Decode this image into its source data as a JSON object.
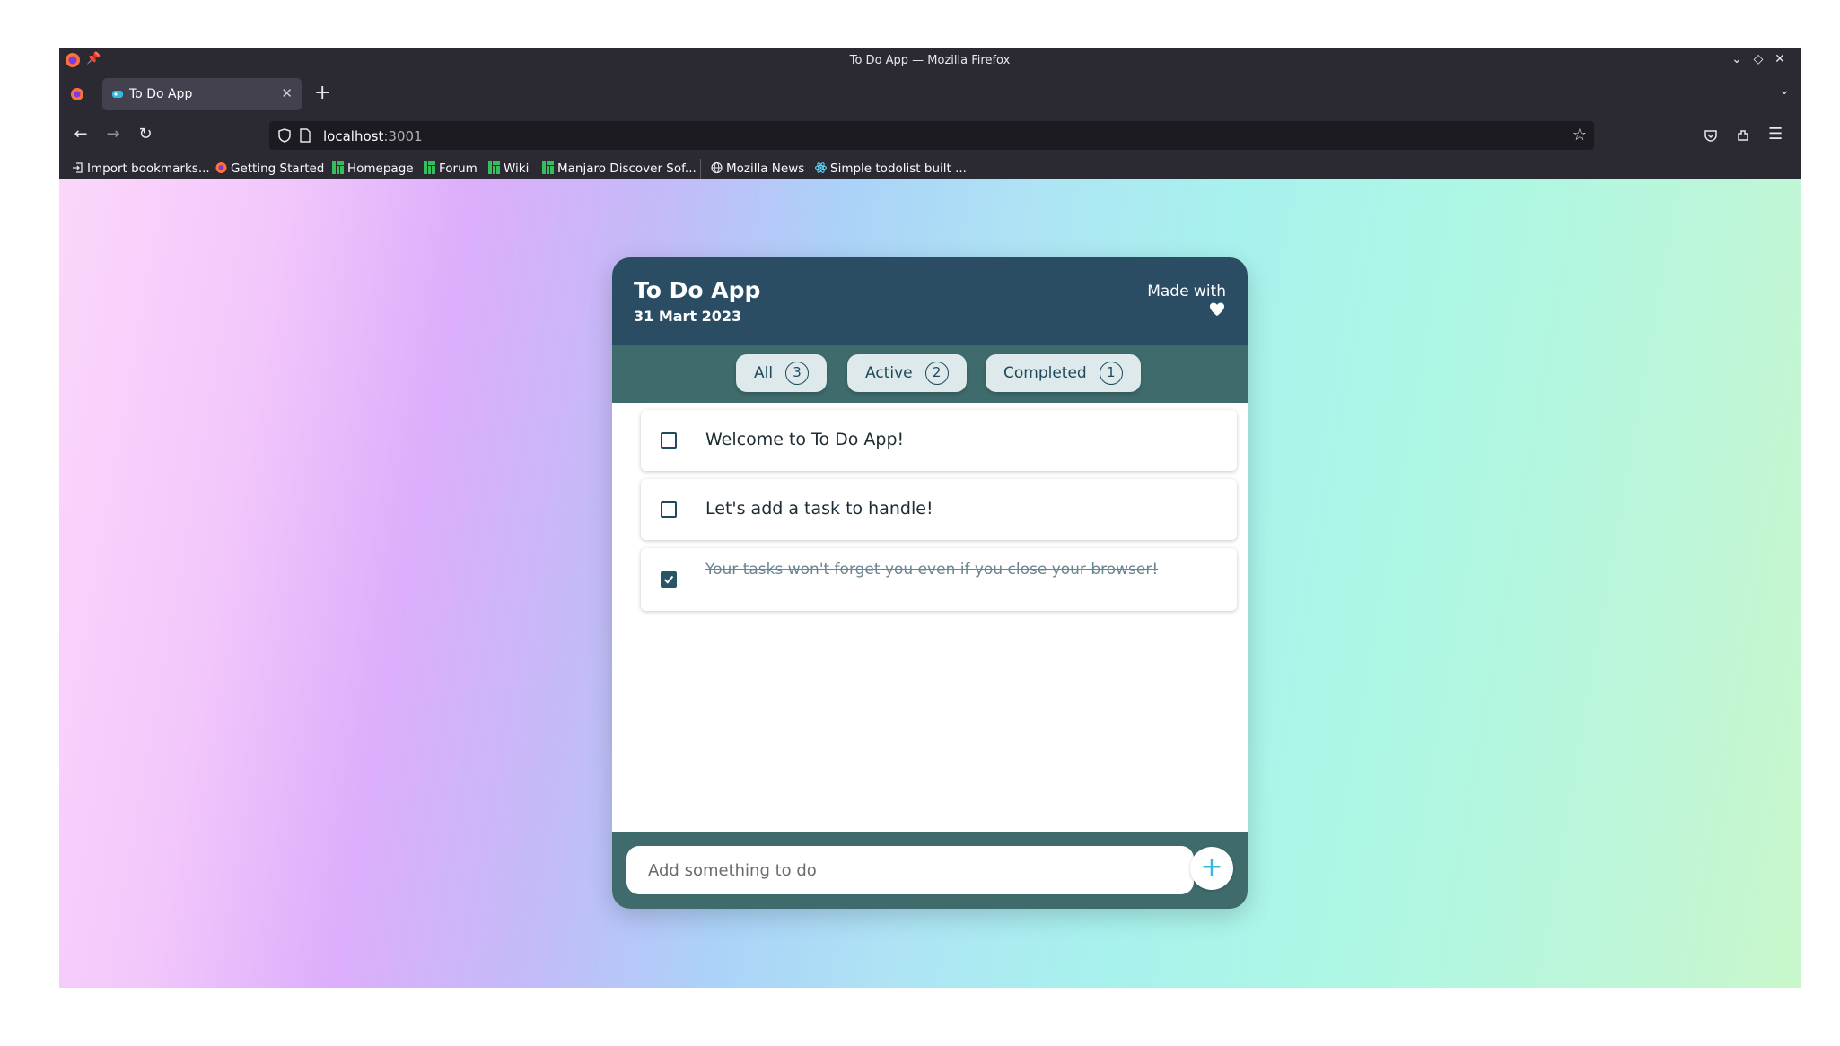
{
  "window": {
    "title": "To Do App — Mozilla Firefox"
  },
  "tabs": [
    {
      "label": "To Do App",
      "active": true
    }
  ],
  "url": {
    "host": "localhost",
    "port": ":3001"
  },
  "bookmarks": [
    {
      "label": "Import bookmarks...",
      "icon": "import-icon"
    },
    {
      "label": "Getting Started",
      "icon": "firefox-icon"
    },
    {
      "label": "Homepage",
      "icon": "manjaro-icon"
    },
    {
      "label": "Forum",
      "icon": "manjaro-icon"
    },
    {
      "label": "Wiki",
      "icon": "manjaro-icon"
    },
    {
      "label": "Manjaro Discover Sof...",
      "icon": "manjaro-icon"
    },
    {
      "label": "Mozilla News",
      "icon": "globe-icon"
    },
    {
      "label": "Simple todolist built ...",
      "icon": "react-icon"
    }
  ],
  "app": {
    "title": "To Do App",
    "date": "31 Mart 2023",
    "made_with": "Made with",
    "filters": [
      {
        "label": "All",
        "count": "3"
      },
      {
        "label": "Active",
        "count": "2"
      },
      {
        "label": "Completed",
        "count": "1"
      }
    ],
    "tasks": [
      {
        "text": "Welcome to To Do App!",
        "completed": false
      },
      {
        "text": "Let's add a task to handle!",
        "completed": false
      },
      {
        "text": "Your tasks won't forget you even if you close your browser!",
        "completed": true
      }
    ],
    "input_placeholder": "Add something to do",
    "add_button": "+"
  },
  "colors": {
    "header": "#2a4d63",
    "filter_bar": "#3f6b6d",
    "accent": "#37b8e0",
    "browser_chrome": "#2b2a33"
  }
}
